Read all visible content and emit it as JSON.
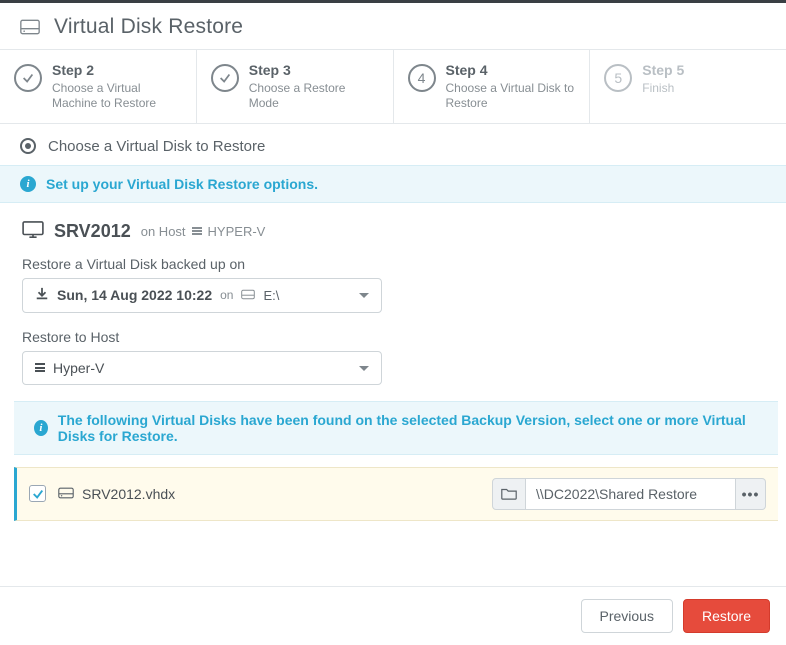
{
  "page": {
    "title": "Virtual Disk Restore"
  },
  "steps": [
    {
      "num": "2",
      "title": "Step 2",
      "desc": "Choose a Virtual Machine to Restore",
      "completed": true
    },
    {
      "num": "3",
      "title": "Step 3",
      "desc": "Choose a Restore Mode",
      "completed": true
    },
    {
      "num": "4",
      "title": "Step 4",
      "desc": "Choose a Virtual Disk to Restore",
      "completed": false,
      "active": true
    },
    {
      "num": "5",
      "title": "Step 5",
      "desc": "Finish",
      "completed": false,
      "faded": true
    }
  ],
  "section": {
    "heading": "Choose a Virtual Disk to Restore"
  },
  "banner1": {
    "text": "Set up your Virtual Disk Restore options."
  },
  "vm": {
    "name": "SRV2012",
    "on_host_label": "on Host",
    "host_name": "HYPER-V"
  },
  "backup_select": {
    "label": "Restore a Virtual Disk backed up on",
    "date": "Sun, 14 Aug 2022 10:22",
    "on_label": "on",
    "target": "E:\\"
  },
  "host_select": {
    "label": "Restore to Host",
    "value": "Hyper-V"
  },
  "banner2": {
    "text": "The following Virtual Disks have been found on the selected Backup Version, select one or more Virtual Disks for Restore."
  },
  "disks": [
    {
      "checked": true,
      "filename": "SRV2012.vhdx",
      "restore_path": "\\\\DC2022\\Shared Restore"
    }
  ],
  "footer": {
    "previous": "Previous",
    "restore": "Restore"
  }
}
